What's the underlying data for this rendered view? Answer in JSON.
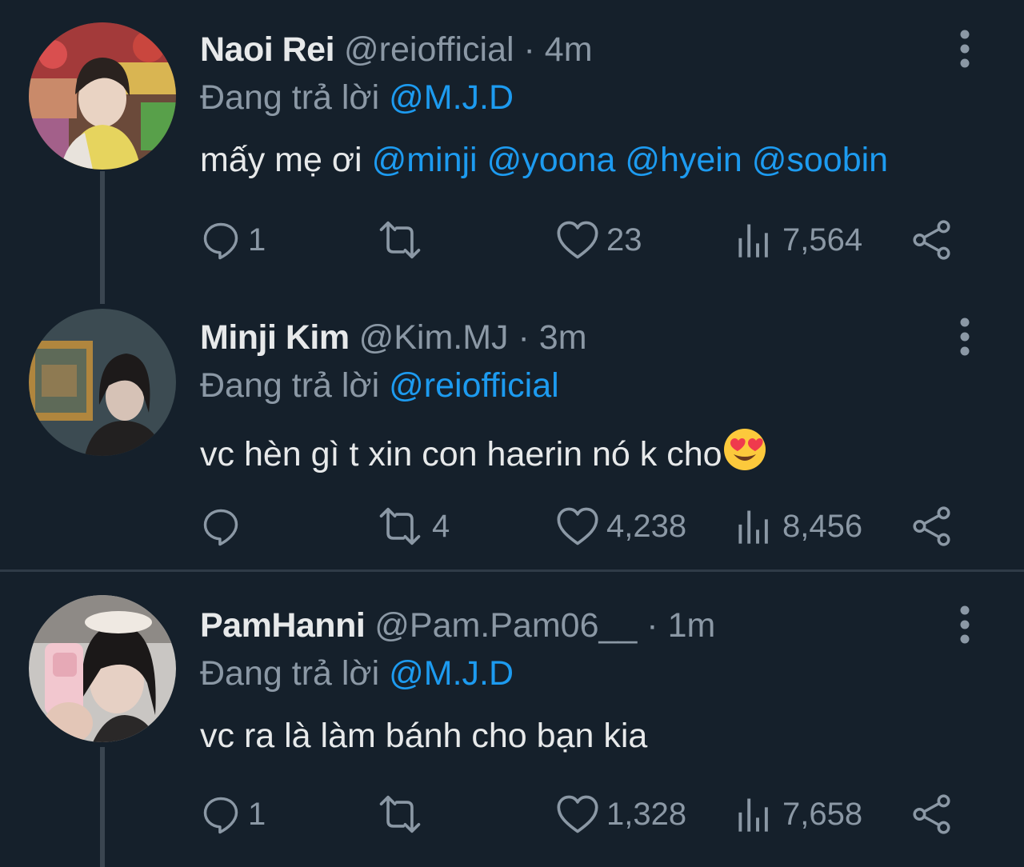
{
  "theme": {
    "background": "#15202b",
    "text": "#e7e9ea",
    "muted": "#8b98a5",
    "accent": "#1d9bf0"
  },
  "tweets": [
    {
      "name": "Naoi Rei",
      "handle": "@reiofficial",
      "dot": "·",
      "time": "4m",
      "replying_prefix": "Đang trả lời ",
      "replying_to": "@M.J.D",
      "text": "mấy mẹ ơi ",
      "mentions": [
        "@minji",
        "@yoona",
        "@hyein",
        "@soobin"
      ],
      "replies": "1",
      "retweets": "",
      "likes": "23",
      "views": "7,564",
      "avatar_icon": "avatar-photo"
    },
    {
      "name": "Minji Kim",
      "handle": "@Kim.MJ",
      "dot": "·",
      "time": "3m",
      "replying_prefix": "Đang trả lời ",
      "replying_to": "@reiofficial",
      "text": "vc hèn gì t xin con haerin nó k cho",
      "emoji": "heart-eyes-emoji",
      "replies": "",
      "retweets": "4",
      "likes": "4,238",
      "views": "8,456",
      "avatar_icon": "avatar-photo"
    },
    {
      "name": "PamHanni",
      "handle": "@Pam.Pam06__",
      "dot": "·",
      "time": "1m",
      "replying_prefix": "Đang trả lời ",
      "replying_to": "@M.J.D",
      "text": "vc ra là làm bánh cho bạn kia",
      "replies": "1",
      "retweets": "",
      "likes": "1,328",
      "views": "7,658",
      "avatar_icon": "avatar-photo"
    }
  ],
  "icons": [
    "reply-icon",
    "retweet-icon",
    "like-icon",
    "views-icon",
    "share-icon",
    "more-icon"
  ]
}
